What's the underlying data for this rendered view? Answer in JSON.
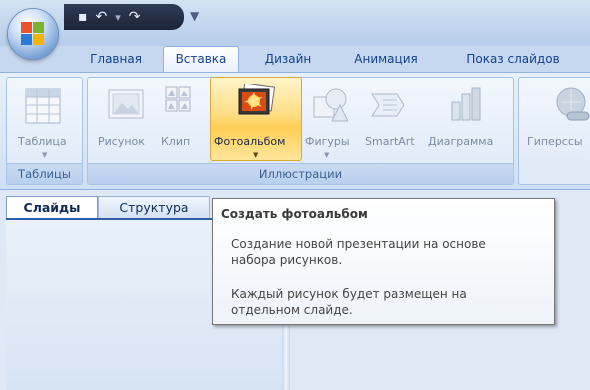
{
  "quick_access": {
    "icons": [
      "save-icon",
      "undo-icon",
      "redo-icon",
      "customize-icon"
    ],
    "customize_glyph": "▼"
  },
  "ribbon_tabs": [
    {
      "label": "Главная",
      "active": false
    },
    {
      "label": "Вставка",
      "active": true
    },
    {
      "label": "Дизайн",
      "active": false
    },
    {
      "label": "Анимация",
      "active": false
    },
    {
      "label": "Показ слайдов",
      "active": false
    }
  ],
  "groups": {
    "tables": {
      "label": "Таблицы",
      "button": {
        "label": "Таблица",
        "icon": "table-icon"
      }
    },
    "illustrations": {
      "label": "Иллюстрации",
      "buttons": [
        {
          "label": "Рисунок",
          "icon": "picture-icon"
        },
        {
          "label": "Клип",
          "icon": "clip-art-icon"
        },
        {
          "label": "Фотоальбом",
          "icon": "photo-album-icon",
          "highlighted": true
        },
        {
          "label": "Фигуры",
          "icon": "shapes-icon"
        },
        {
          "label": "SmartArt",
          "icon": "smartart-icon"
        },
        {
          "label": "Диаграмма",
          "icon": "chart-icon"
        }
      ]
    },
    "links": {
      "button": {
        "label": "Гиперссы",
        "icon": "hyperlink-icon"
      }
    }
  },
  "pane_tabs": [
    {
      "label": "Слайды",
      "active": true
    },
    {
      "label": "Структура",
      "active": false
    }
  ],
  "tooltip": {
    "title": "Создать фотоальбом",
    "line1": "Создание новой презентации на основе",
    "line2": "набора рисунков.",
    "line3": "Каждый рисунок будет размещен на",
    "line4": "отдельном слайде."
  },
  "colors": {
    "ribbon_text": "#15428b",
    "highlight": "#ffd36b",
    "tooltip_border": "#767676"
  }
}
